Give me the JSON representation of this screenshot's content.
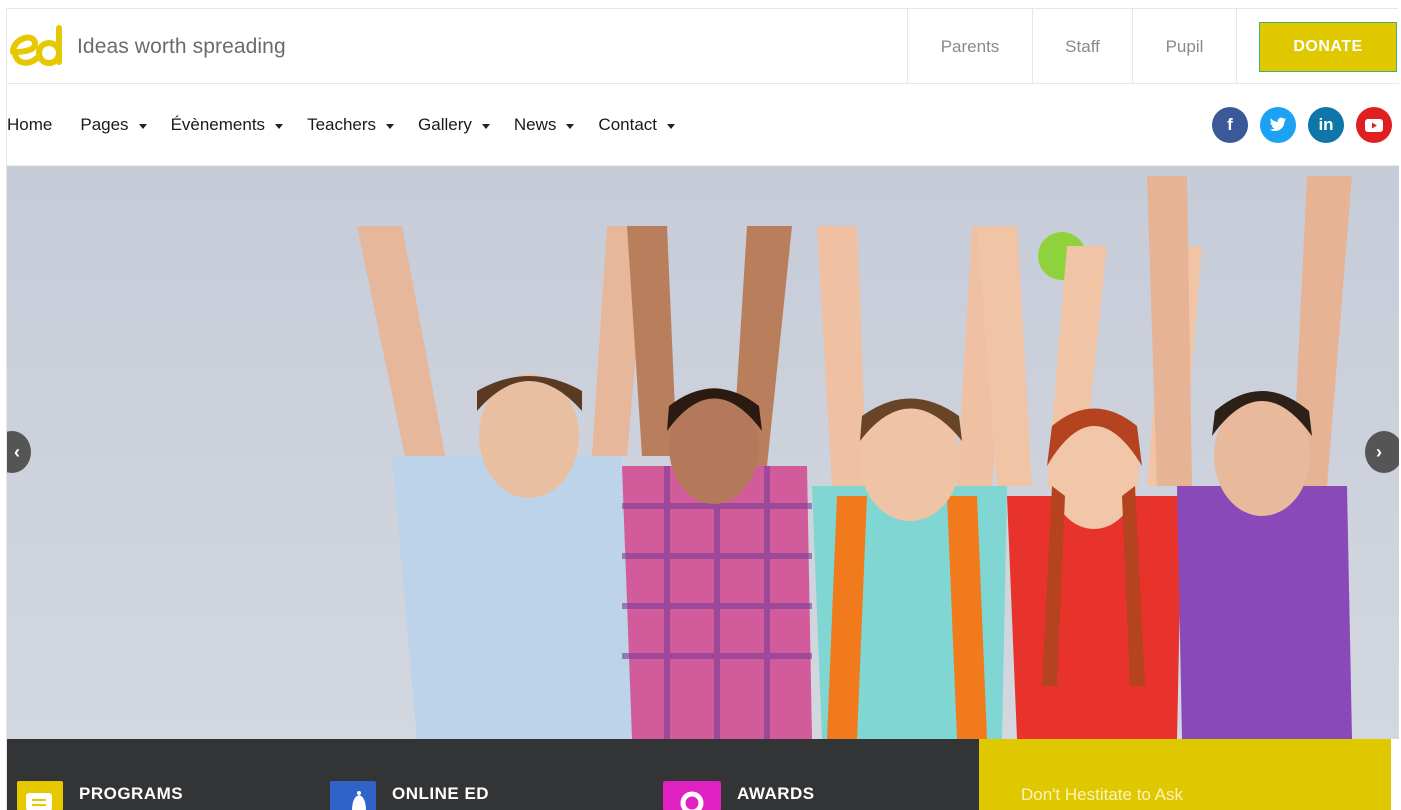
{
  "brand": {
    "logo_text": "ed",
    "tagline": "Ideas worth spreading",
    "accent_color": "#e0c800"
  },
  "top_links": [
    "Parents",
    "Staff",
    "Pupil"
  ],
  "donate_label": "DONATE",
  "nav": {
    "items": [
      {
        "label": "Home",
        "has_dropdown": false
      },
      {
        "label": "Pages",
        "has_dropdown": true
      },
      {
        "label": "Évènements",
        "has_dropdown": true
      },
      {
        "label": "Teachers",
        "has_dropdown": true
      },
      {
        "label": "Gallery",
        "has_dropdown": true
      },
      {
        "label": "News",
        "has_dropdown": true
      },
      {
        "label": "Contact",
        "has_dropdown": true
      }
    ]
  },
  "social": [
    {
      "icon": "facebook-icon",
      "glyph": "f",
      "color": "#3b5998"
    },
    {
      "icon": "twitter-icon",
      "glyph": "t",
      "color": "#1da1f2"
    },
    {
      "icon": "linkedin-icon",
      "glyph": "in",
      "color": "#0e76a8"
    },
    {
      "icon": "youtube-icon",
      "glyph": "▶",
      "color": "#e02020"
    }
  ],
  "hero": {
    "image": "children-raising-hands-photo",
    "prev_icon": "chevron-left-icon",
    "next_icon": "chevron-right-icon",
    "prev_glyph": "‹",
    "next_glyph": "›"
  },
  "features": [
    {
      "title": "PROGRAMS",
      "icon": "document-icon",
      "color": "#e6c800"
    },
    {
      "title": "ONLINE ED",
      "icon": "bell-icon",
      "color": "#2f63c9"
    },
    {
      "title": "AWARDS",
      "icon": "award-icon",
      "color": "#e020c0"
    }
  ],
  "ask": {
    "text": "Don't Hestitate to Ask"
  }
}
